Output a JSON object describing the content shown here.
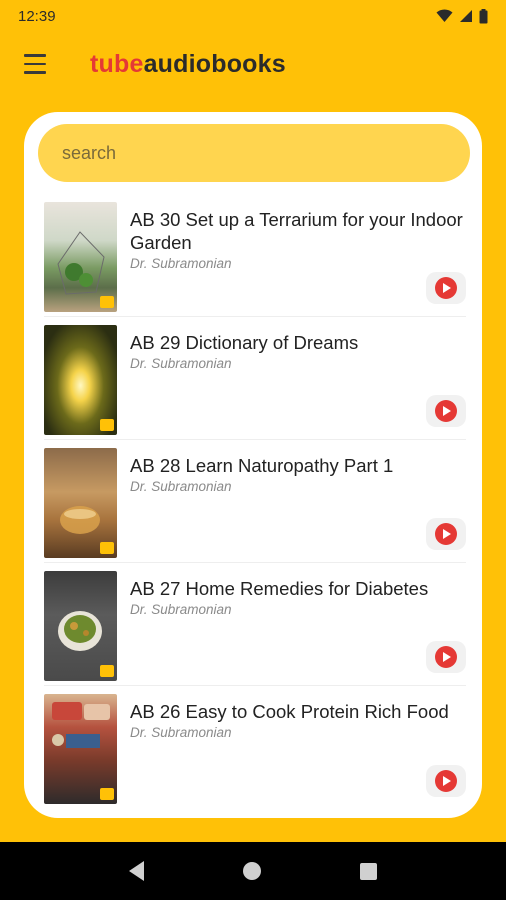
{
  "status_bar": {
    "time": "12:39",
    "icons": [
      "wifi-icon",
      "signal-icon",
      "battery-icon"
    ]
  },
  "app_bar": {
    "menu_icon": "menu-icon",
    "brand_part1": "tube",
    "brand_part2": "audiobooks"
  },
  "search": {
    "placeholder": "search"
  },
  "books": [
    {
      "title": "AB 30 Set up a Terrarium for your Indoor Garden",
      "author": "Dr. Subramonian",
      "cover_text": ""
    },
    {
      "title": "AB 29 Dictionary of Dreams",
      "author": "Dr. Subramonian",
      "cover_text": ""
    },
    {
      "title": "AB 28 Learn Naturopathy Part 1",
      "author": "Dr. Subramonian",
      "cover_text": ""
    },
    {
      "title": "AB 27 Home Remedies for Diabetes",
      "author": "Dr. Subramonian",
      "cover_text": ""
    },
    {
      "title": "AB 26 Easy to Cook Protein Rich Food",
      "author": "Dr. Subramonian",
      "cover_text": ""
    }
  ],
  "colors": {
    "background": "#FFC107",
    "search_bg": "#FFD54F",
    "brand_red": "#E53935",
    "play_red": "#E53935"
  },
  "nav_bar": {
    "icons": [
      "back-icon",
      "home-icon",
      "recents-icon"
    ]
  }
}
